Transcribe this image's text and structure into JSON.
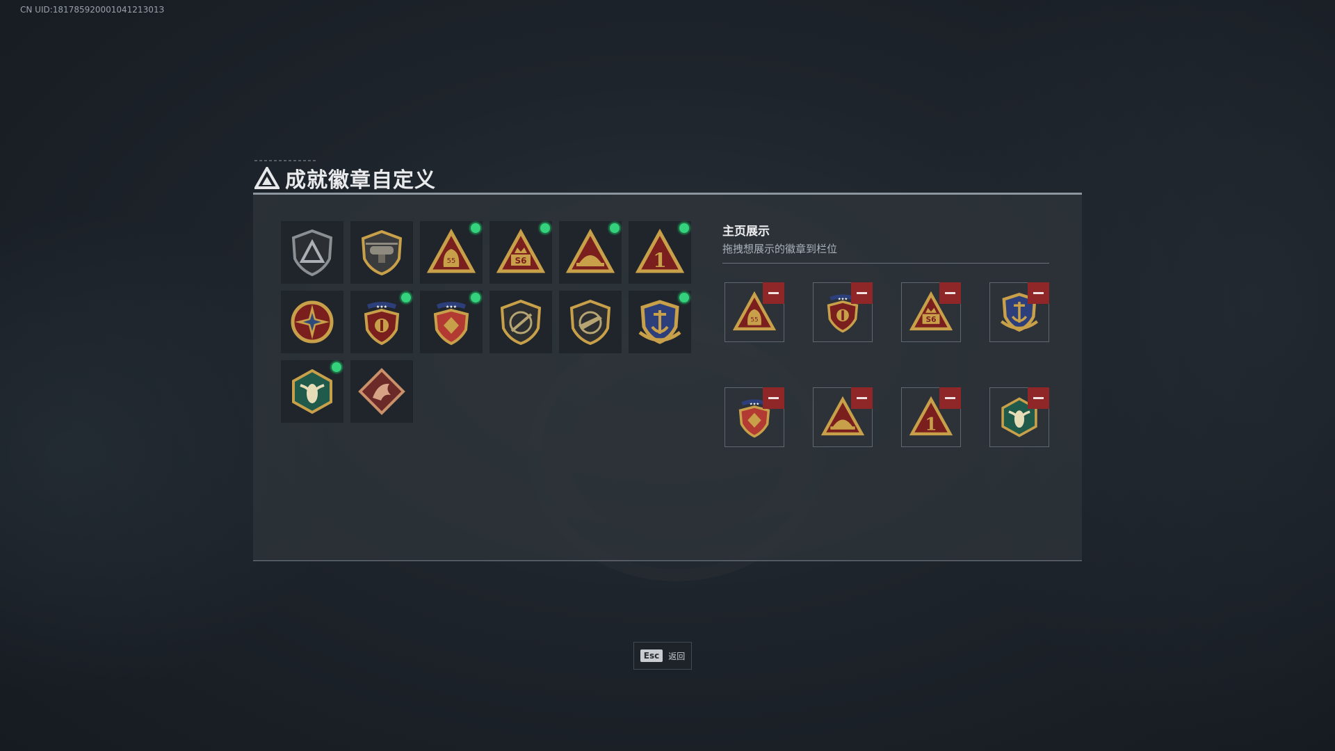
{
  "uid_text": "CN UID:18178592000104121301З",
  "title": "成就徽章自定义",
  "showcase": {
    "title": "主页展示",
    "subtitle": "拖拽想展示的徽章到栏位"
  },
  "badges": [
    {
      "icon": "triangle-shield-icon",
      "new": false
    },
    {
      "icon": "helicopter-shield-icon",
      "new": false
    },
    {
      "icon": "bag-55-triangle-icon",
      "new": true
    },
    {
      "icon": "s6-triangle-icon",
      "new": true
    },
    {
      "icon": "hat-triangle-icon",
      "new": true
    },
    {
      "icon": "number-1-triangle-icon",
      "new": true
    },
    {
      "icon": "star-compass-icon",
      "new": false
    },
    {
      "icon": "crest-star-shield-icon",
      "new": true
    },
    {
      "icon": "crest-red-shield-icon",
      "new": true
    },
    {
      "icon": "gun-shield-icon",
      "new": false
    },
    {
      "icon": "rifle-shield-icon",
      "new": false
    },
    {
      "icon": "anchor-eagle-icon",
      "new": true
    },
    {
      "icon": "hornet-hexagon-icon",
      "new": true
    },
    {
      "icon": "dragon-diamond-icon",
      "new": false
    }
  ],
  "display_slots": [
    {
      "icon": "bag-55-triangle-icon"
    },
    {
      "icon": "crest-star-shield-icon"
    },
    {
      "icon": "s6-triangle-icon"
    },
    {
      "icon": "anchor-eagle-icon"
    },
    {
      "icon": "crest-red-shield-icon"
    },
    {
      "icon": "hat-triangle-icon"
    },
    {
      "icon": "number-1-triangle-icon"
    },
    {
      "icon": "hornet-hexagon-icon"
    }
  ],
  "footer": {
    "esc_key": "Esc",
    "esc_label": "返回"
  },
  "colors": {
    "new_dot": "#34d27d",
    "remove_button": "#8f2628",
    "badge_gold": "#c9a04a",
    "badge_red": "#7a1f1e"
  }
}
